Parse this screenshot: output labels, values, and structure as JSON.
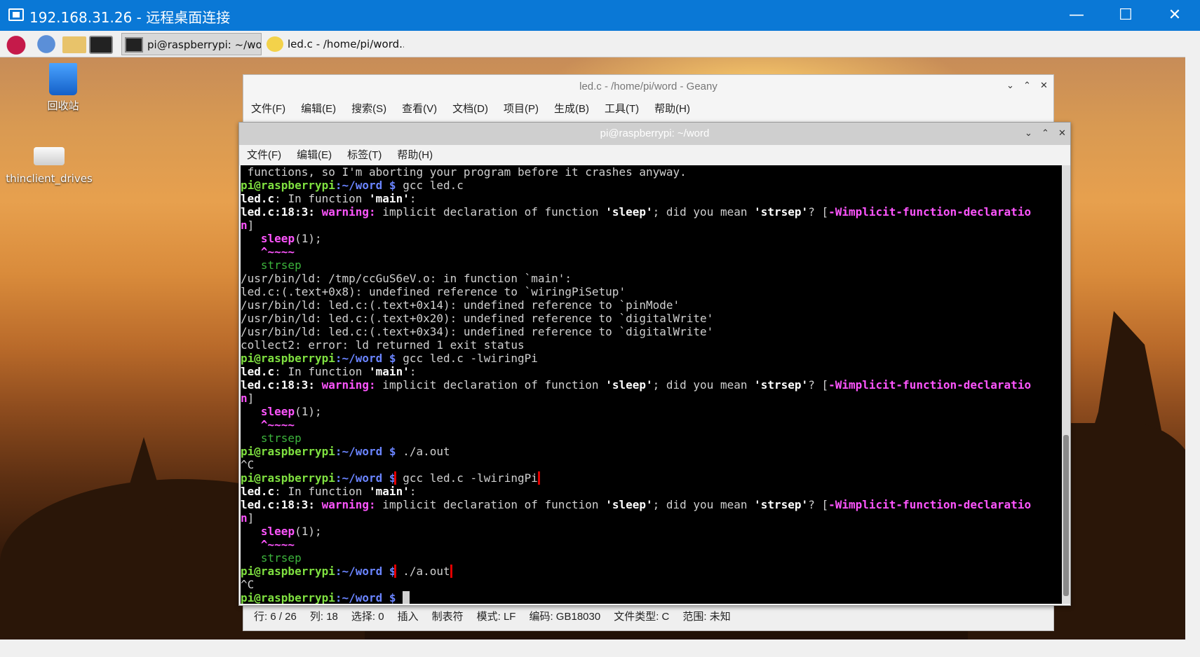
{
  "rdp": {
    "title": "192.168.31.26 - 远程桌面连接",
    "minimize": "—",
    "maximize": "☐",
    "close": "✕"
  },
  "taskbar": {
    "items": [
      {
        "label": "pi@raspberrypi: ~/wo..."
      },
      {
        "label": "led.c - /home/pi/word..."
      }
    ]
  },
  "desktop": {
    "icons": [
      {
        "label": "回收站"
      },
      {
        "label": "thinclient_drives"
      }
    ]
  },
  "geany": {
    "title": "led.c - /home/pi/word - Geany",
    "menu": [
      "文件(F)",
      "编辑(E)",
      "搜索(S)",
      "查看(V)",
      "文档(D)",
      "项目(P)",
      "生成(B)",
      "工具(T)",
      "帮助(H)"
    ],
    "status": [
      "行: 6 / 26",
      "列: 18",
      "选择: 0",
      "插入",
      "制表符",
      "模式: LF",
      "编码: GB18030",
      "文件类型: C",
      "范围: 未知"
    ]
  },
  "terminal": {
    "title": "pi@raspberrypi: ~/word",
    "menu": [
      "文件(F)",
      "编辑(E)",
      "标签(T)",
      "帮助(H)"
    ],
    "prompt_user": "pi@raspberrypi",
    "prompt_path": ":~/word $",
    "lines": [
      " functions, so I'm aborting your program before it crashes anyway.",
      "gcc led.c",
      "led.c: In function 'main':",
      "led.c:18:3: warning: implicit declaration of function 'sleep'; did you mean 'strsep'? [-Wimplicit-function-declaratio",
      "n]",
      "   sleep(1);",
      "   ^~~~~",
      "   strsep",
      "/usr/bin/ld: /tmp/ccGuS6eV.o: in function `main':",
      "led.c:(.text+0x8): undefined reference to `wiringPiSetup'",
      "/usr/bin/ld: led.c:(.text+0x14): undefined reference to `pinMode'",
      "/usr/bin/ld: led.c:(.text+0x20): undefined reference to `digitalWrite'",
      "/usr/bin/ld: led.c:(.text+0x34): undefined reference to `digitalWrite'",
      "collect2: error: ld returned 1 exit status",
      "gcc led.c -lwiringPi",
      "./a.out",
      "^C",
      ""
    ]
  }
}
